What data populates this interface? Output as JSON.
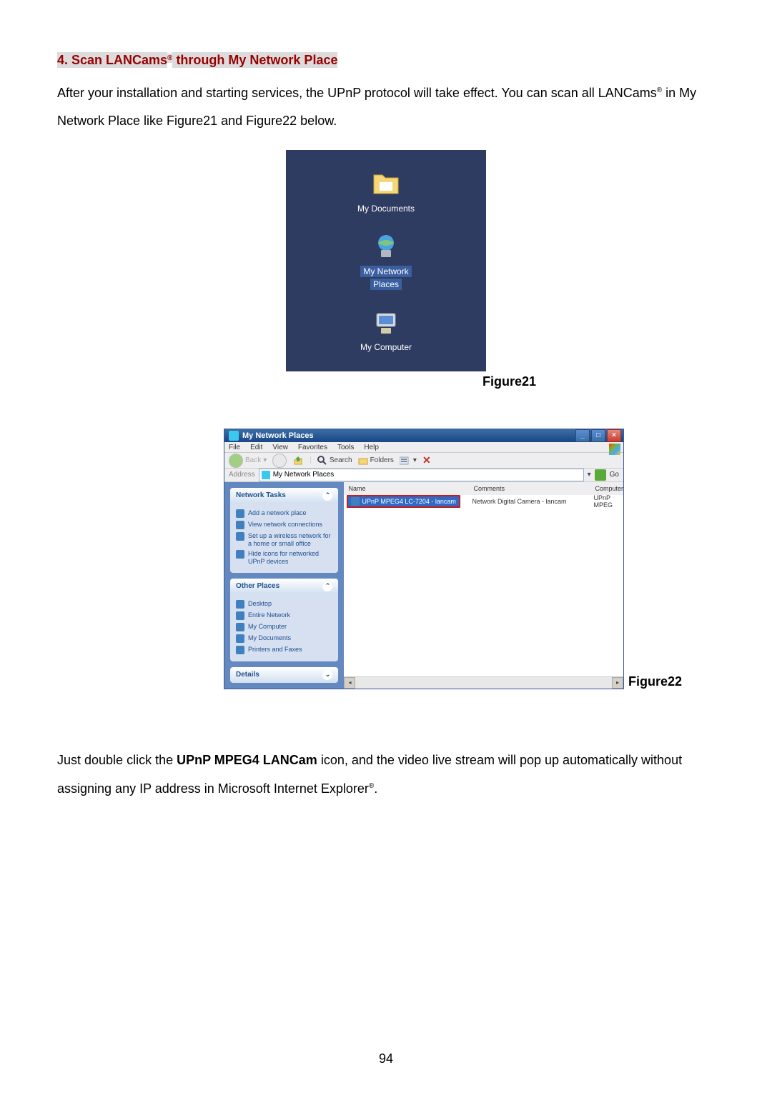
{
  "heading": {
    "prefix": "4. Scan LANCams",
    "reg": "®",
    "suffix": " through My Network Place"
  },
  "para1": {
    "line1": "After your installation and starting services, the UPnP protocol will take effect. You can scan all ",
    "line2_prefix": "LANCams",
    "line2_reg": "®",
    "line2_suffix": " in My Network Place like Figure21 and Figure22 below."
  },
  "figure1": {
    "icons": {
      "docs": "My Documents",
      "network_l1": "My Network",
      "network_l2": "Places",
      "computer": "My Computer"
    },
    "caption": "Figure21"
  },
  "figure2": {
    "title": "My Network Places",
    "menubar": [
      "File",
      "Edit",
      "View",
      "Favorites",
      "Tools",
      "Help"
    ],
    "toolbar": {
      "back": "Back",
      "search": "Search",
      "folders": "Folders"
    },
    "addressbar": {
      "label": "Address",
      "value": "My Network Places",
      "go": "Go"
    },
    "sidebar": {
      "panel1": {
        "title": "Network Tasks",
        "items": [
          "Add a network place",
          "View network connections",
          "Set up a wireless network for a home or small office",
          "Hide icons for networked UPnP devices"
        ]
      },
      "panel2": {
        "title": "Other Places",
        "items": [
          "Desktop",
          "Entire Network",
          "My Computer",
          "My Documents",
          "Printers and Faxes"
        ]
      },
      "panel3": {
        "title": "Details"
      }
    },
    "columns": {
      "name": "Name",
      "comments": "Comments",
      "computer": "Computer"
    },
    "row": {
      "name": "UPnP MPEG4 LC-7204 - lancam",
      "comments": "Network Digital Camera - lancam",
      "computer": "UPnP MPEG"
    },
    "caption": "Figure22"
  },
  "para2": {
    "part1": "Just double click the ",
    "bold": "UPnP MPEG4 LANCam",
    "part2": " icon, and the video live stream will pop up ",
    "part3_prefix": "automatically without assigning any IP address in Microsoft Internet Explorer",
    "part3_reg": "®",
    "part3_suffix": "."
  },
  "page_number": "94"
}
